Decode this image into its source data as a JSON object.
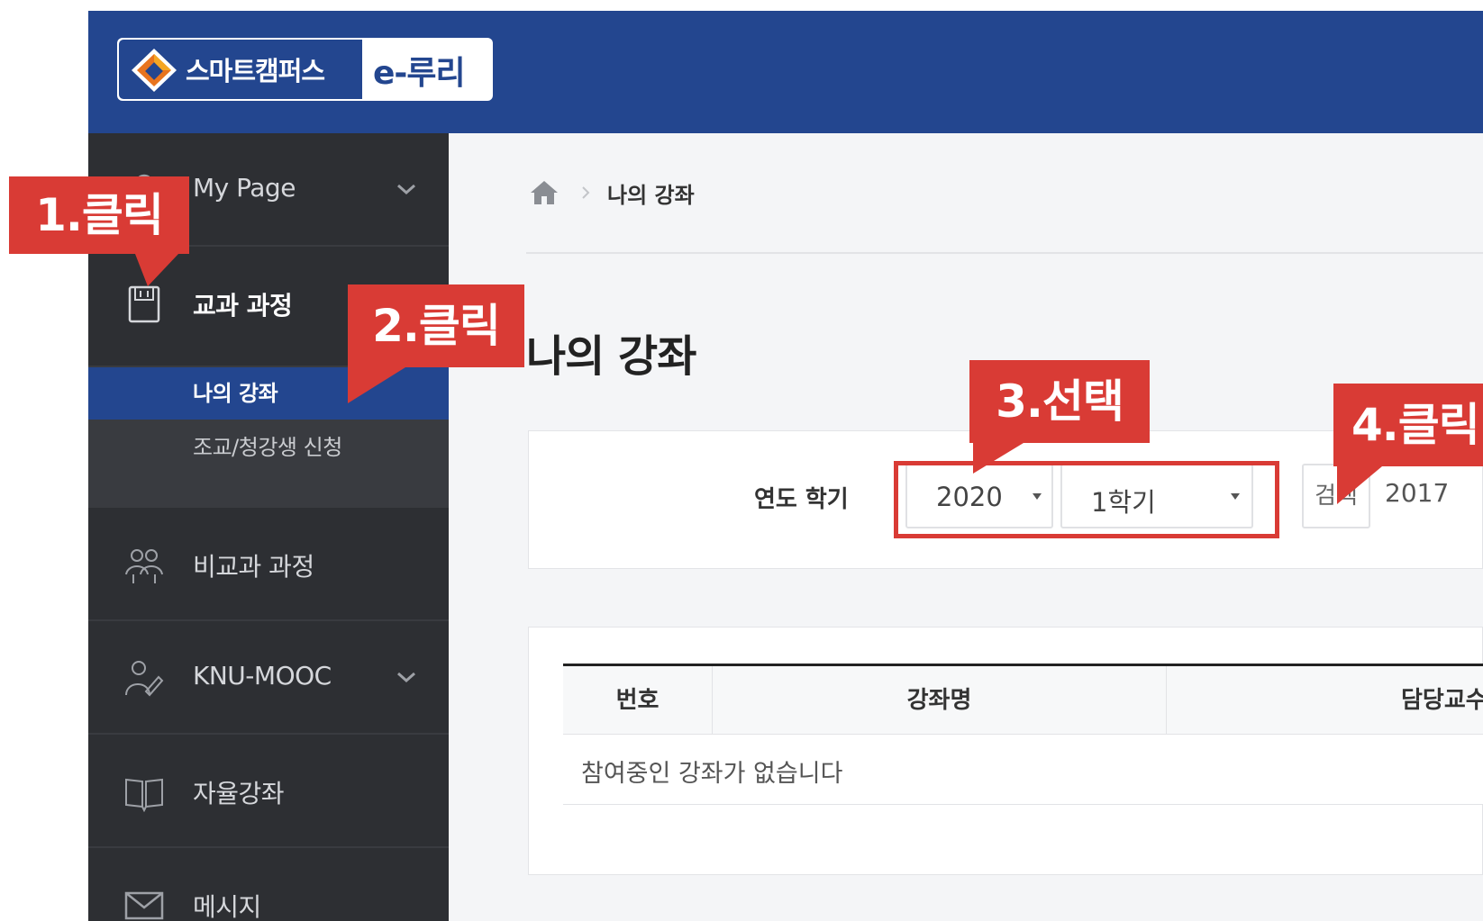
{
  "header": {
    "logo_name": "스마트캠퍼스",
    "logo_eruri": "e-루리",
    "brand_color": "#23468f"
  },
  "sidebar": {
    "items": [
      {
        "label": "My Page",
        "icon": "person-icon",
        "has_chevron": true
      },
      {
        "label": "교과 과정",
        "icon": "book-icon",
        "active": true
      },
      {
        "label": "비교과 과정",
        "icon": "group-icon"
      },
      {
        "label": "KNU-MOOC",
        "icon": "student-icon",
        "has_chevron": true
      },
      {
        "label": "자율강좌",
        "icon": "open-book-icon"
      },
      {
        "label": "메시지",
        "icon": "mail-icon"
      }
    ],
    "subitems": [
      {
        "label": "나의 강좌",
        "selected": true
      },
      {
        "label": "조교/청강생 신청"
      }
    ]
  },
  "breadcrumb": {
    "home_icon": "home-icon",
    "current": "나의 강좌"
  },
  "page": {
    "title": "나의 강좌"
  },
  "filter": {
    "label": "연도 학기",
    "year_value": "2020",
    "semester_value": "1학기",
    "search_label": "검색",
    "year_range": "2017"
  },
  "table": {
    "headers": [
      "번호",
      "강좌명",
      "담당교수"
    ],
    "empty_message": "참여중인 강좌가 없습니다"
  },
  "annotations": {
    "step1": "1.클릭",
    "step2": "2.클릭",
    "step3": "3.선택",
    "step4": "4.클릭",
    "color": "#d93b35"
  }
}
